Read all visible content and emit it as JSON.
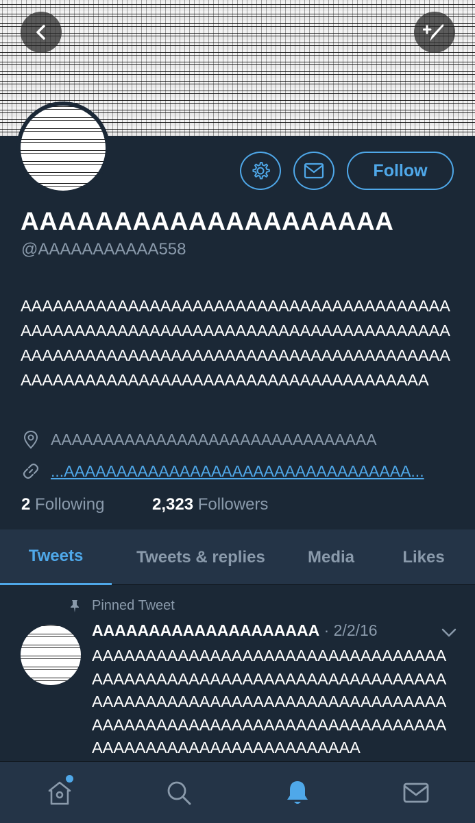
{
  "profile": {
    "display_name": "AAAAAAAAAAAAAAAAAAAA",
    "handle": "@AAAAAAAAAAA558",
    "bio": "AAAAAAAAAAAAAAAAAAAAAAAAAAAAAAAAAAAAAAAAAAAAAAAAAAAAAAAAAAAAAAAAAAAAAAAAAAAAAAAAAAAAAAAAAAAAAAAAAAAAAAAAAAAAAAAAAAAAAAAAAAAAAAAAAAAAAAAAAAAAAAAAAAAAAAAAAAAAAA",
    "location": "AAAAAAAAAAAAAAAAAAAAAAAAAAAAAAA",
    "link": "...AAAAAAAAAAAAAAAAAAAAAAAAAAAAAAAAA...",
    "following_count": "2",
    "following_label": "Following",
    "followers_count": "2,323",
    "followers_label": "Followers",
    "follow_label": "Follow"
  },
  "tabs": [
    {
      "label": "Tweets",
      "active": true
    },
    {
      "label": "Tweets & replies",
      "active": false
    },
    {
      "label": "Media",
      "active": false
    },
    {
      "label": "Likes",
      "active": false
    }
  ],
  "pinned_tweet": {
    "pinned_label": "Pinned Tweet",
    "author": "AAAAAAAAAAAAAAAAAAAA",
    "date": " · 2/2/16",
    "text": "AAAAAAAAAAAAAAAAAAAAAAAAAAAAAAAAAAAAAAAAAAAAAAAAAAAAAAAAAAAAAAAAAAAAAAAAAAAAAAAAAAAAAAAAAAAAAAAAAAAAAAAAAAAAAAAAAAAAAAAAAAAAAAAAAAAAAAAAAAAAAAAAAAAAAAAAAAAAA"
  },
  "colors": {
    "background": "#1b2836",
    "surface": "#243447",
    "accent": "#4fa8e9",
    "muted_text": "#8a9aab"
  },
  "icons": {
    "back": "chevron-left-icon",
    "compose": "compose-icon",
    "settings": "gear-icon",
    "message": "envelope-icon",
    "location": "map-pin-icon",
    "link": "link-icon",
    "pin": "pin-icon",
    "caret": "chevron-down-icon",
    "home": "home-icon",
    "search": "search-icon",
    "notifications": "bell-icon",
    "messages": "envelope-icon"
  }
}
